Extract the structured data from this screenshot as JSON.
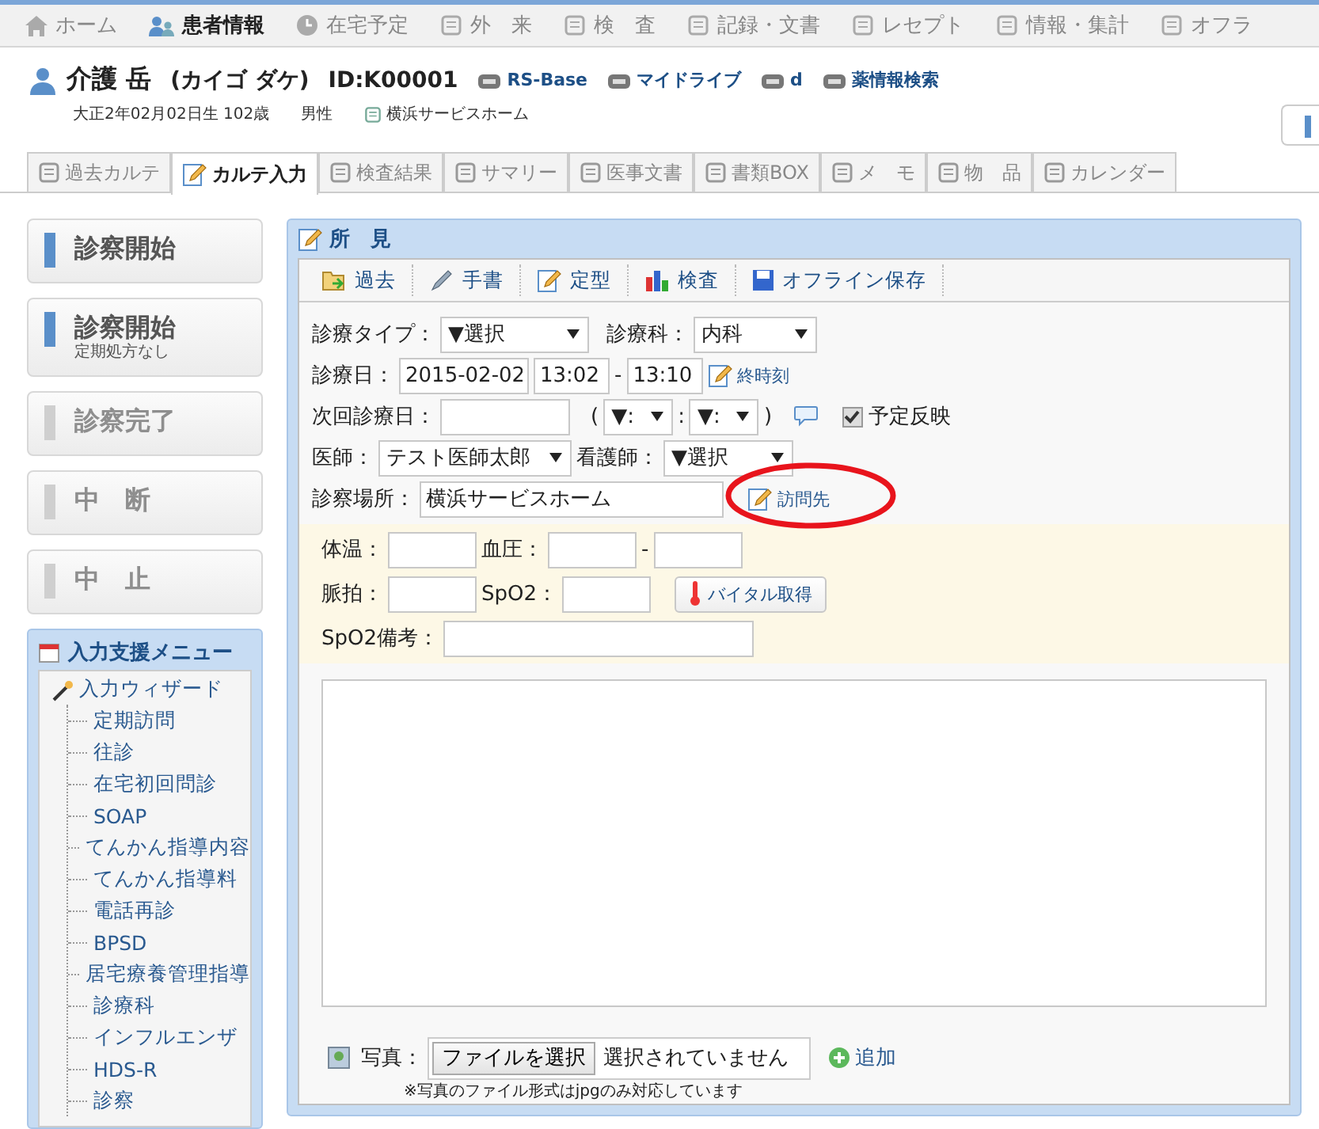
{
  "top_nav": [
    {
      "label": "ホーム",
      "selected": false
    },
    {
      "label": "患者情報",
      "selected": true
    },
    {
      "label": "在宅予定",
      "selected": false
    },
    {
      "label": "外　来",
      "selected": false
    },
    {
      "label": "検　査",
      "selected": false
    },
    {
      "label": "記録・文書",
      "selected": false
    },
    {
      "label": "レセプト",
      "selected": false
    },
    {
      "label": "情報・集計",
      "selected": false
    },
    {
      "label": "オフラ",
      "selected": false
    }
  ],
  "patient": {
    "name": "介護 岳",
    "kana": "(カイゴ ダケ)",
    "id": "ID:K00001",
    "links": [
      "RS-Base",
      "マイドライブ",
      "d",
      "薬情報検索"
    ],
    "birth": "大正2年02月02日生 102歳",
    "sex": "男性",
    "facility": "横浜サービスホーム"
  },
  "tabs": [
    {
      "label": "過去カルテ",
      "selected": false
    },
    {
      "label": "カルテ入力",
      "selected": true
    },
    {
      "label": "検査結果",
      "selected": false
    },
    {
      "label": "サマリー",
      "selected": false
    },
    {
      "label": "医事文書",
      "selected": false
    },
    {
      "label": "書類BOX",
      "selected": false
    },
    {
      "label": "メ　モ",
      "selected": false
    },
    {
      "label": "物　品",
      "selected": false
    },
    {
      "label": "カレンダー",
      "selected": false
    }
  ],
  "actions": [
    {
      "label": "診察開始",
      "disabled": false
    },
    {
      "label": "診察開始",
      "sub": "定期処方なし",
      "disabled": false
    },
    {
      "label": "診察完了",
      "disabled": true
    },
    {
      "label": "中　断",
      "disabled": true
    },
    {
      "label": "中　止",
      "disabled": true
    }
  ],
  "assist_menu": {
    "title": "入力支援メニュー",
    "items": [
      {
        "label": "入力ウィザード",
        "expanded": true,
        "children": [
          {
            "label": "定期訪問"
          },
          {
            "label": "往診"
          },
          {
            "label": "在宅初回問診"
          },
          {
            "label": "SOAP"
          },
          {
            "label": "てんかん指導内容"
          },
          {
            "label": "てんかん指導料"
          },
          {
            "label": "電話再診"
          },
          {
            "label": "BPSD"
          },
          {
            "label": "居宅療養管理指導"
          },
          {
            "label": "診療科"
          },
          {
            "label": "インフルエンザ"
          },
          {
            "label": "HDS-R"
          },
          {
            "label": "診察"
          }
        ]
      }
    ]
  },
  "findings": {
    "title": "所　見",
    "toolbar": [
      "過去",
      "手書",
      "定型",
      "検査",
      "オフライン保存"
    ],
    "visit_type": {
      "label": "診療タイプ：",
      "value": "▼選択"
    },
    "department": {
      "label": "診療科：",
      "value": "内科"
    },
    "date": {
      "label": "診療日：",
      "value": "2015-02-02",
      "start": "13:02",
      "separator": "-",
      "end": "13:10",
      "button": "終時刻"
    },
    "next_date": {
      "label": "次回診療日：",
      "open": "(",
      "hour": "▼:",
      "colon": ":",
      "minute": "▼:",
      "close": ")",
      "checkbox": {
        "label": "予定反映",
        "checked": true
      }
    },
    "doctor": {
      "label": "医師：",
      "value": "テスト医師太郎"
    },
    "nurse": {
      "label": "看護師：",
      "value": "▼選択"
    },
    "place": {
      "label": "診察場所：",
      "value": "横浜サービスホーム",
      "button": "訪問先",
      "highlighted": true
    },
    "vitals": {
      "temperature": "体温：",
      "blood_pressure": "血圧：",
      "separator": "-",
      "pulse": "脈拍：",
      "spo2": "SpO2：",
      "button": "バイタル取得",
      "spo2_note": "SpO2備考："
    },
    "photo": {
      "label": "写真：",
      "file_button": "ファイルを選択",
      "file_status": "選択されていません",
      "add": "追加",
      "note": "※写真のファイル形式はjpgのみ対応しています"
    }
  }
}
